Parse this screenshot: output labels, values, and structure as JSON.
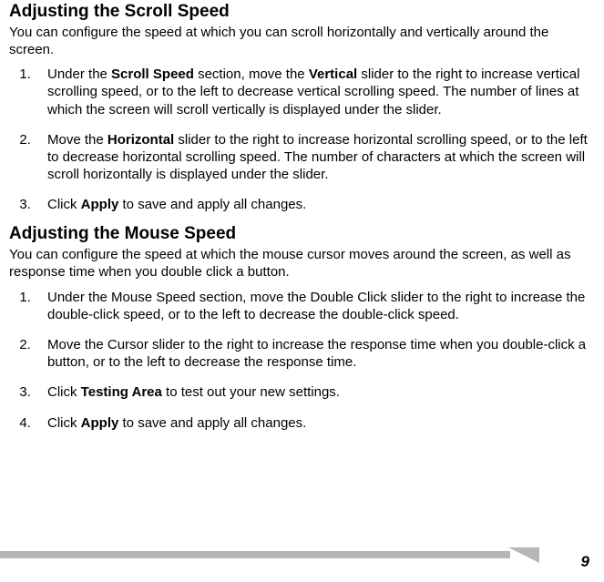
{
  "section1": {
    "title": "Adjusting the Scroll Speed",
    "intro": "You can configure the speed at which you can scroll horizontally and vertically around the screen.",
    "steps": [
      {
        "pre1": "Under the ",
        "b1": "Scroll Speed",
        "mid1": " section, move the ",
        "b2": "Vertical",
        "post1": " slider to the right to increase vertical scrolling speed, or to the left to decrease vertical scrolling speed. The number of lines at which the screen will scroll vertically is displayed under the slider."
      },
      {
        "pre1": "Move the ",
        "b1": "Horizontal",
        "post1": " slider to the right to increase horizontal scrolling speed, or to the left to decrease horizontal scrolling speed. The number of characters at which the screen will scroll horizontally is displayed under the slider."
      },
      {
        "pre1": "Click ",
        "b1": "Apply",
        "post1": " to save and apply all changes."
      }
    ]
  },
  "section2": {
    "title": "Adjusting the Mouse Speed",
    "intro": "You can configure the speed at which the mouse cursor moves around the screen, as well as response time when you double click a button.",
    "steps": [
      {
        "text": "Under the Mouse Speed section, move the Double Click slider to the right to increase the double-click speed, or to the left to decrease the double-click speed."
      },
      {
        "text": "Move the Cursor slider to the right to increase the response time when you double-click a button, or to the left to decrease the response time."
      },
      {
        "pre1": "Click ",
        "b1": "Testing Area",
        "post1": " to test out your new settings."
      },
      {
        "pre1": "Click ",
        "b1": "Apply",
        "post1": " to save and apply all changes."
      }
    ]
  },
  "page_number": "9"
}
